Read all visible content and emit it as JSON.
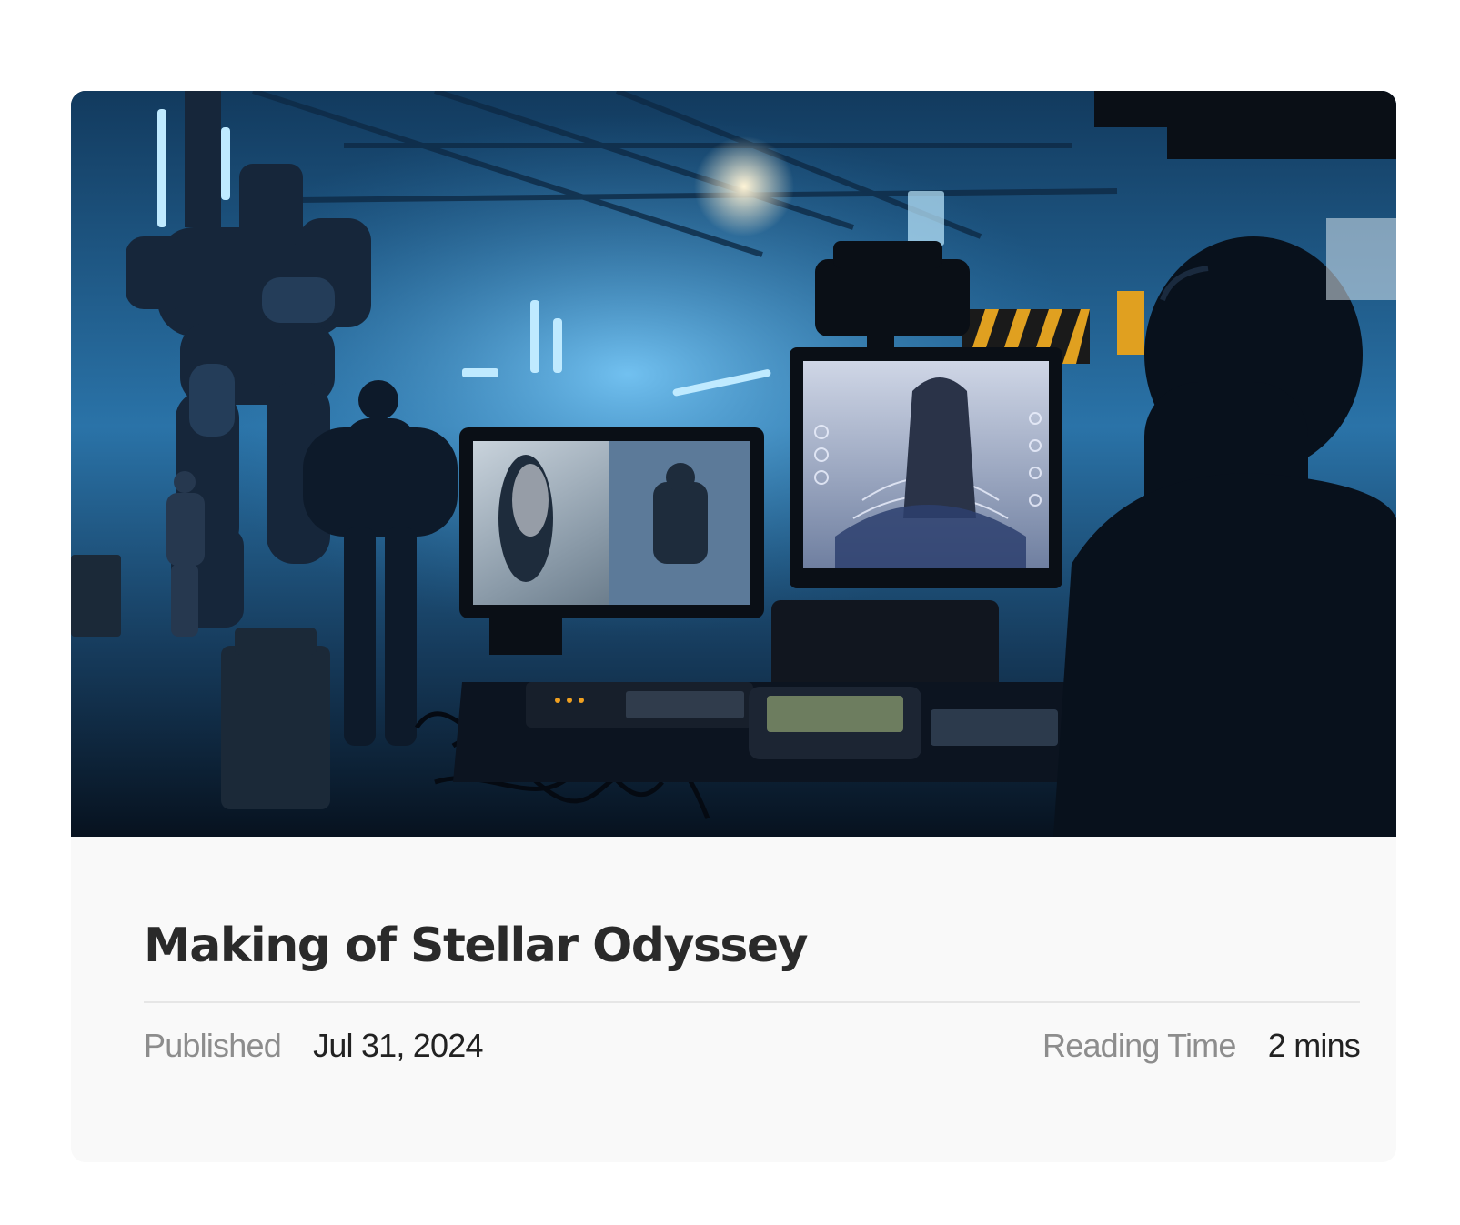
{
  "card": {
    "image_alt": "Behind-the-scenes film set with robots and monitors",
    "title": "Making of Stellar Odyssey",
    "meta": {
      "published_label": "Published",
      "published_value": "Jul 31, 2024",
      "reading_label": "Reading Time",
      "reading_value": "2 mins"
    }
  },
  "colors": {
    "card_background": "#f9f9f9",
    "title": "#2a2a2a",
    "meta_label": "#8d8d8d",
    "meta_value": "#222222",
    "divider": "#e6e6e6"
  }
}
